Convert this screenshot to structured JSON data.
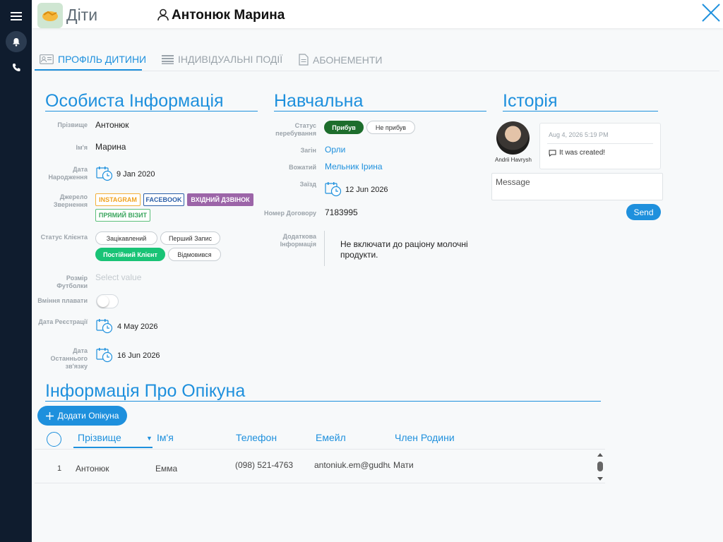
{
  "header": {
    "app_title": "Діти",
    "user_name": "Антонюк Марина"
  },
  "tabs": [
    {
      "label": "ПРОФІЛЬ ДИТИНИ",
      "active": true
    },
    {
      "label": "ІНДИВІДУАЛЬНІ ПОДІЇ",
      "active": false
    },
    {
      "label": "АБОНЕМЕНТИ",
      "active": false
    }
  ],
  "personal": {
    "title": "Особиста Інформація",
    "surname_label": "Прізвище",
    "surname": "Антонюк",
    "name_label": "Ім'я",
    "name": "Марина",
    "birth_label": "Дата Народження",
    "birth_date": "9 Jan 2020",
    "source_label": "Джерело Звернення",
    "sources": [
      "INSTAGRAM",
      "FACEBOOK",
      "ВХІДНИЙ ДЗВІНОК",
      "ПРЯМИЙ ВІЗИТ"
    ],
    "client_status_label": "Статус Клієнта",
    "client_statuses": [
      "Зацікавлений",
      "Перший Запис",
      "Постійний Клієнт",
      "Відмовився"
    ],
    "shirt_label": "Розмір Футболки",
    "shirt_placeholder": "Select value",
    "swim_label": "Вміння плавати",
    "reg_label": "Дата Реєстрації",
    "reg_date": "4 May 2026",
    "last_contact_label": "Дата Останнього зв'язку",
    "last_contact_date": "16 Jun 2026"
  },
  "education": {
    "title": "Навчальна",
    "status_label": "Статус перебування",
    "status_options": [
      "Прибув",
      "Не прибув"
    ],
    "group_label": "Загін",
    "group": "Орли",
    "counselor_label": "Вожатий",
    "counselor": "Мельник Ірина",
    "arrival_label": "Заїзд",
    "arrival_date": "12 Jun 2026",
    "contract_label": "Номер Договору",
    "contract": "7183995",
    "extra_label": "Додаткова Інформація",
    "extra": "Не включати до раціону молочні продукти."
  },
  "history": {
    "title": "Історія",
    "author": "Andrii Havrysh",
    "time": "Aug 4, 2026 5:19 PM",
    "message": "It was created!",
    "input_placeholder": "Message",
    "send_label": "Send"
  },
  "guardians": {
    "title": "Інформація Про Опікуна",
    "add_label": "Додати Опікуна",
    "columns": [
      "Прізвище",
      "Ім'я",
      "Телефон",
      "Емейл",
      "Член Родини"
    ],
    "rows": [
      {
        "index": "1",
        "surname": "Антонюк",
        "name": "Емма",
        "phone": "(098) 521-4763",
        "email": "antoniuk.em@gudhub.com",
        "relation": "Мати"
      }
    ]
  },
  "colors": {
    "accent": "#1e90dd",
    "rail": "#0f1c2e",
    "green": "#19c376",
    "dark_green": "#1d6d2c"
  }
}
